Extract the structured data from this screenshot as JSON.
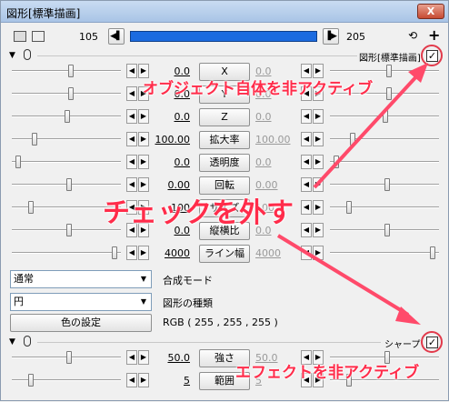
{
  "window": {
    "title": "図形[標準描画]",
    "close": "X"
  },
  "timeline": {
    "start": "105",
    "end": "205",
    "start_btn": "◀▌",
    "end_btn": "▐▶",
    "plus": "+",
    "loop_icon": "⟲"
  },
  "section1": {
    "label": "図形[標準描画]",
    "checked": "✓"
  },
  "params": [
    {
      "left": "0.0",
      "name": "X",
      "right": "0.0"
    },
    {
      "left": "0.0",
      "name": "Y",
      "right": "0.0"
    },
    {
      "left": "0.0",
      "name": "Z",
      "right": "0.0"
    },
    {
      "left": "100.00",
      "name": "拡大率",
      "right": "100.00"
    },
    {
      "left": "0.0",
      "name": "透明度",
      "right": "0.0"
    },
    {
      "left": "0.00",
      "name": "回転",
      "right": "0.00"
    },
    {
      "left": "100",
      "name": "サイズ",
      "right": "100"
    },
    {
      "left": "0.0",
      "name": "縦横比",
      "right": "0.0"
    },
    {
      "left": "4000",
      "name": "ライン幅",
      "right": "4000"
    }
  ],
  "blend": {
    "value": "通常",
    "label": "合成モード"
  },
  "shape": {
    "value": "円",
    "label": "図形の種類"
  },
  "color": {
    "button": "色の設定",
    "value": "RGB ( 255 , 255 , 255 )"
  },
  "section2": {
    "label": "シャープ",
    "checked": "✓"
  },
  "params2": [
    {
      "left": "50.0",
      "name": "強さ",
      "right": "50.0"
    },
    {
      "left": "5",
      "name": "範囲",
      "right": "5"
    }
  ],
  "annotations": {
    "a1": "オブジェクト自体を非アクティブ",
    "a2": "チェックを外す",
    "a3": "エフェクトを非アクティブ"
  },
  "colors": {
    "accent": "#ff2c4a",
    "timeline_bar": "#1b6be0"
  }
}
